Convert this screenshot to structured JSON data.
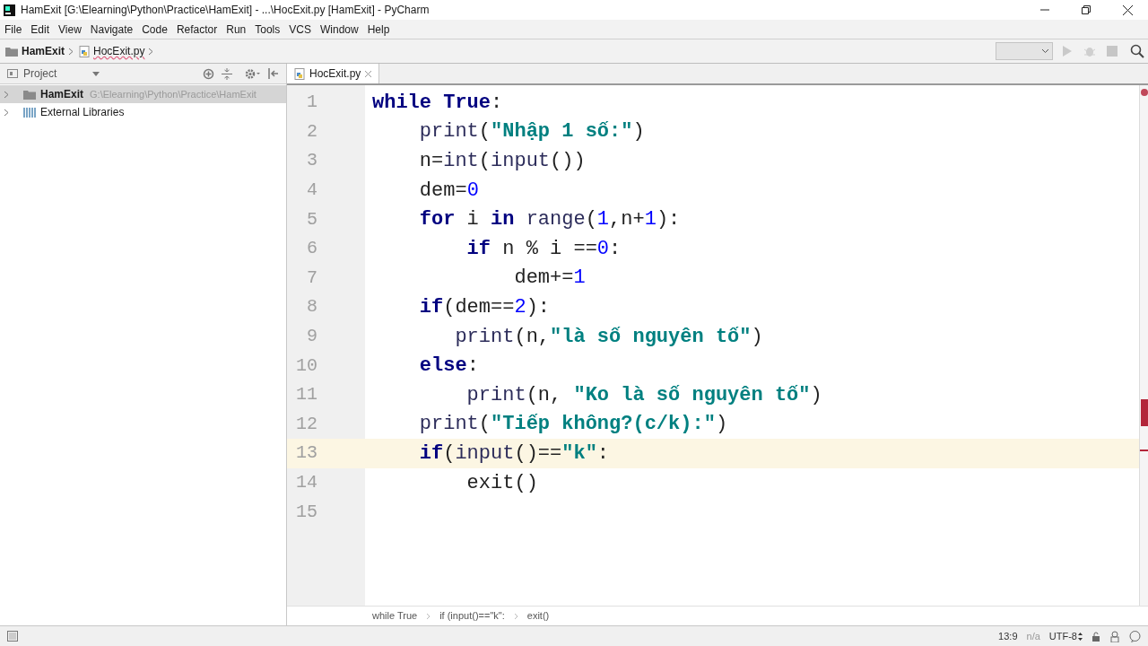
{
  "window": {
    "title": "HamExit [G:\\Elearning\\Python\\Practice\\HamExit] - ...\\HocExit.py [HamExit] - PyCharm"
  },
  "menu": [
    "File",
    "Edit",
    "View",
    "Navigate",
    "Code",
    "Refactor",
    "Run",
    "Tools",
    "VCS",
    "Window",
    "Help"
  ],
  "navigation": [
    {
      "kind": "folder",
      "label": "HamExit"
    },
    {
      "kind": "file",
      "label": "HocExit.py"
    }
  ],
  "project_panel": {
    "title": "Project",
    "items": [
      {
        "label": "HamExit",
        "path": "G:\\Elearning\\Python\\Practice\\HamExit",
        "kind": "folder",
        "selected": true
      },
      {
        "label": "External Libraries",
        "kind": "library",
        "selected": false
      }
    ]
  },
  "tabs": [
    {
      "label": "HocExit.py",
      "selected": true
    }
  ],
  "editor": {
    "lines": [
      {
        "number": "1",
        "current": false,
        "tokens": [
          {
            "kind": "kw",
            "text": "while"
          },
          {
            "kind": "kw",
            "text": " True"
          },
          {
            "kind": "plain",
            "text": ":"
          }
        ]
      },
      {
        "number": "2",
        "current": false,
        "tokens": [
          {
            "kind": "builtin",
            "text": "    print"
          },
          {
            "kind": "plain",
            "text": "("
          },
          {
            "kind": "str",
            "text": "\"Nhập 1 số:\""
          },
          {
            "kind": "plain",
            "text": ")"
          }
        ]
      },
      {
        "number": "3",
        "current": false,
        "tokens": [
          {
            "kind": "plain",
            "text": "    n="
          },
          {
            "kind": "builtin",
            "text": "int"
          },
          {
            "kind": "plain",
            "text": "("
          },
          {
            "kind": "builtin",
            "text": "input"
          },
          {
            "kind": "plain",
            "text": "())"
          }
        ]
      },
      {
        "number": "4",
        "current": false,
        "tokens": [
          {
            "kind": "plain",
            "text": "    dem="
          },
          {
            "kind": "num",
            "text": "0"
          }
        ]
      },
      {
        "number": "5",
        "current": false,
        "tokens": [
          {
            "kind": "kw",
            "text": "    for"
          },
          {
            "kind": "plain",
            "text": " i "
          },
          {
            "kind": "kw",
            "text": "in"
          },
          {
            "kind": "builtin",
            "text": " range"
          },
          {
            "kind": "plain",
            "text": "("
          },
          {
            "kind": "num",
            "text": "1"
          },
          {
            "kind": "plain",
            "text": ",n+"
          },
          {
            "kind": "num",
            "text": "1"
          },
          {
            "kind": "plain",
            "text": "):"
          }
        ]
      },
      {
        "number": "6",
        "current": false,
        "tokens": [
          {
            "kind": "kw",
            "text": "        if"
          },
          {
            "kind": "plain",
            "text": " n % i =="
          },
          {
            "kind": "num",
            "text": "0"
          },
          {
            "kind": "plain",
            "text": ":"
          }
        ]
      },
      {
        "number": "7",
        "current": false,
        "tokens": [
          {
            "kind": "plain",
            "text": "            dem+="
          },
          {
            "kind": "num",
            "text": "1"
          }
        ]
      },
      {
        "number": "8",
        "current": false,
        "tokens": [
          {
            "kind": "kw",
            "text": "    if"
          },
          {
            "kind": "plain",
            "text": "(dem=="
          },
          {
            "kind": "num",
            "text": "2"
          },
          {
            "kind": "plain",
            "text": "):"
          }
        ]
      },
      {
        "number": "9",
        "current": false,
        "tokens": [
          {
            "kind": "builtin",
            "text": "       print"
          },
          {
            "kind": "plain",
            "text": "(n,"
          },
          {
            "kind": "str",
            "text": "\"là số nguyên tố\""
          },
          {
            "kind": "plain",
            "text": ")"
          }
        ]
      },
      {
        "number": "10",
        "current": false,
        "tokens": [
          {
            "kind": "kw",
            "text": "    else"
          },
          {
            "kind": "plain",
            "text": ":"
          }
        ]
      },
      {
        "number": "11",
        "current": false,
        "tokens": [
          {
            "kind": "builtin",
            "text": "        print"
          },
          {
            "kind": "plain",
            "text": "(n, "
          },
          {
            "kind": "str",
            "text": "\"Ko là số nguyên tố\""
          },
          {
            "kind": "plain",
            "text": ")"
          }
        ]
      },
      {
        "number": "12",
        "current": false,
        "tokens": [
          {
            "kind": "builtin",
            "text": "    print"
          },
          {
            "kind": "plain",
            "text": "("
          },
          {
            "kind": "str",
            "text": "\"Tiếp không?(c/k):\""
          },
          {
            "kind": "plain",
            "text": ")"
          }
        ]
      },
      {
        "number": "13",
        "current": true,
        "tokens": [
          {
            "kind": "kw",
            "text": "    if"
          },
          {
            "kind": "plain",
            "text": "("
          },
          {
            "kind": "builtin",
            "text": "input"
          },
          {
            "kind": "plain",
            "text": "()=="
          },
          {
            "kind": "str",
            "text": "\"k\""
          },
          {
            "kind": "plain",
            "text": ":"
          }
        ]
      },
      {
        "number": "14",
        "current": false,
        "tokens": [
          {
            "kind": "plain",
            "text": "        exit()"
          }
        ]
      },
      {
        "number": "15",
        "current": false
      }
    ]
  },
  "breadcrumbs": [
    "while True",
    "if (input()==\"k\":",
    "exit()"
  ],
  "status_bar": {
    "position": "13:9",
    "line_separator": "n/a",
    "encoding": "UTF-8"
  }
}
